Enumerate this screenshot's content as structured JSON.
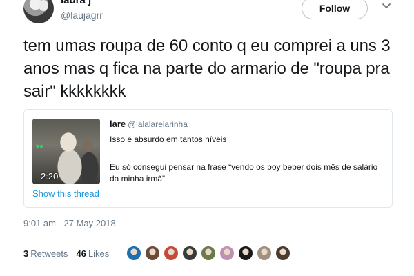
{
  "author": {
    "name": "laura j",
    "handle": "@laujagrr",
    "avatar_icon": "profile-photo"
  },
  "follow_label": "Follow",
  "tweet_text": "tem umas roupa de 60 conto q eu comprei a uns 3 anos mas q fica na parte do armario de \"roupa pra sair\" kkkkkkkk",
  "quoted": {
    "name": "lare",
    "handle": "@lalalarelarinha",
    "line1": "Isso é absurdo em tantos níveis",
    "line2": "Eu só consegui pensar na frase “vendo os boy beber dois mês de salário da minha irmã”",
    "video_duration": "2:20",
    "show_thread": "Show this thread"
  },
  "timestamp": "9:01 am - 27 May 2018",
  "stats": {
    "retweets_count": "3",
    "retweets_label": "Retweets",
    "likes_count": "46",
    "likes_label": "Likes"
  },
  "liker_colors": [
    "#1e6fb0",
    "#6b4a3a",
    "#c44a3a",
    "#3a3a3a",
    "#6b7a4a",
    "#c090b0",
    "#1a1a1a",
    "#a09080",
    "#4a3a30"
  ]
}
